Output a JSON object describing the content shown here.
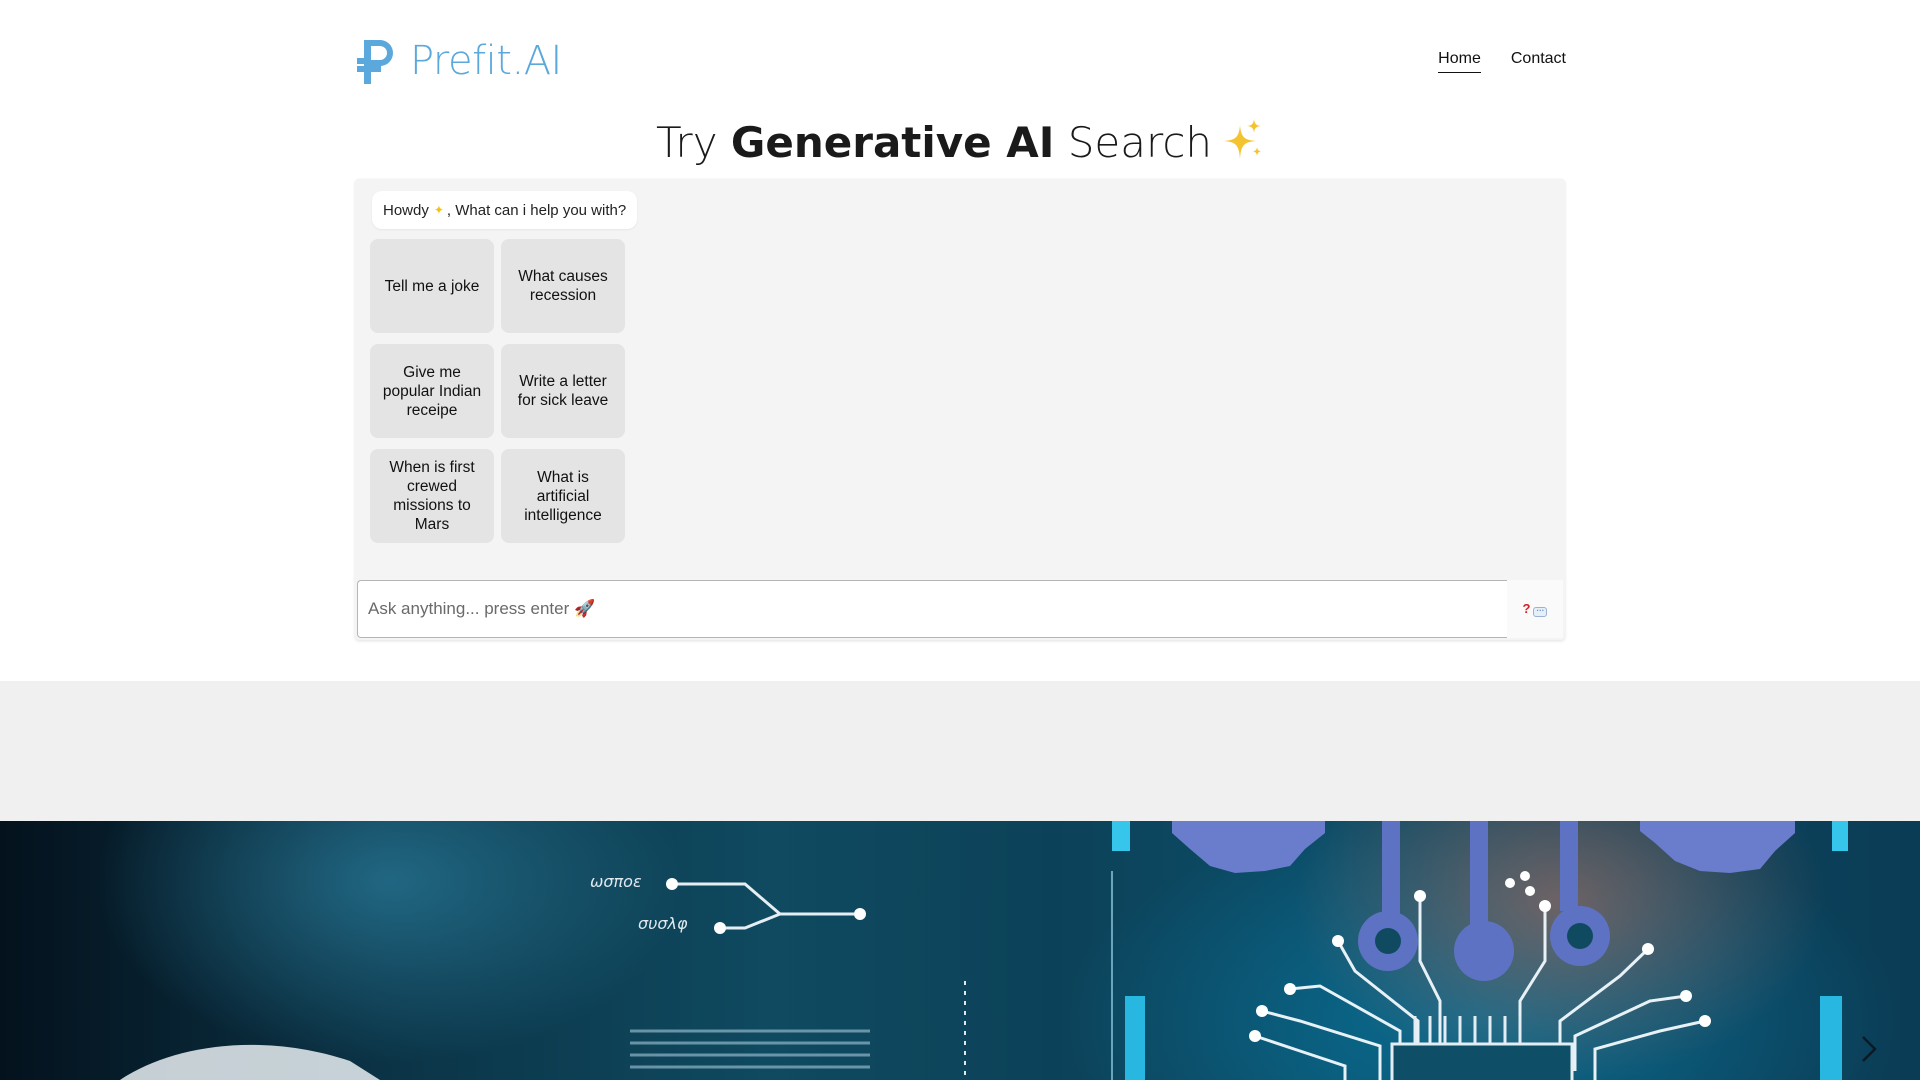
{
  "brand": {
    "name": "Prefit.AI",
    "logo_icon": "ruble-p-logo-icon",
    "color": "#5aa8dc"
  },
  "nav": {
    "items": [
      {
        "label": "Home",
        "active": true
      },
      {
        "label": "Contact",
        "active": false
      }
    ]
  },
  "hero": {
    "title_prefix": "Try ",
    "title_bold": "Generative AI",
    "title_suffix": " Search",
    "title_icon": "sparkles-icon"
  },
  "chat": {
    "greeting_prefix": "Howdy",
    "greeting_icon": "sparkles-icon",
    "greeting_suffix": ", What can i help you with?",
    "suggestions": [
      "Tell me a joke",
      "What causes recession",
      "Give me popular Indian receipe",
      "Write a letter for sick leave",
      "When is first crewed missions to Mars",
      "What is artificial intelligence"
    ],
    "input_placeholder": "Ask anything... press enter 🚀",
    "help_icon": "question-speech-icon"
  },
  "banner": {
    "image": "ai-circuit-brain-illustration",
    "next_icon": "chevron-right-icon"
  }
}
